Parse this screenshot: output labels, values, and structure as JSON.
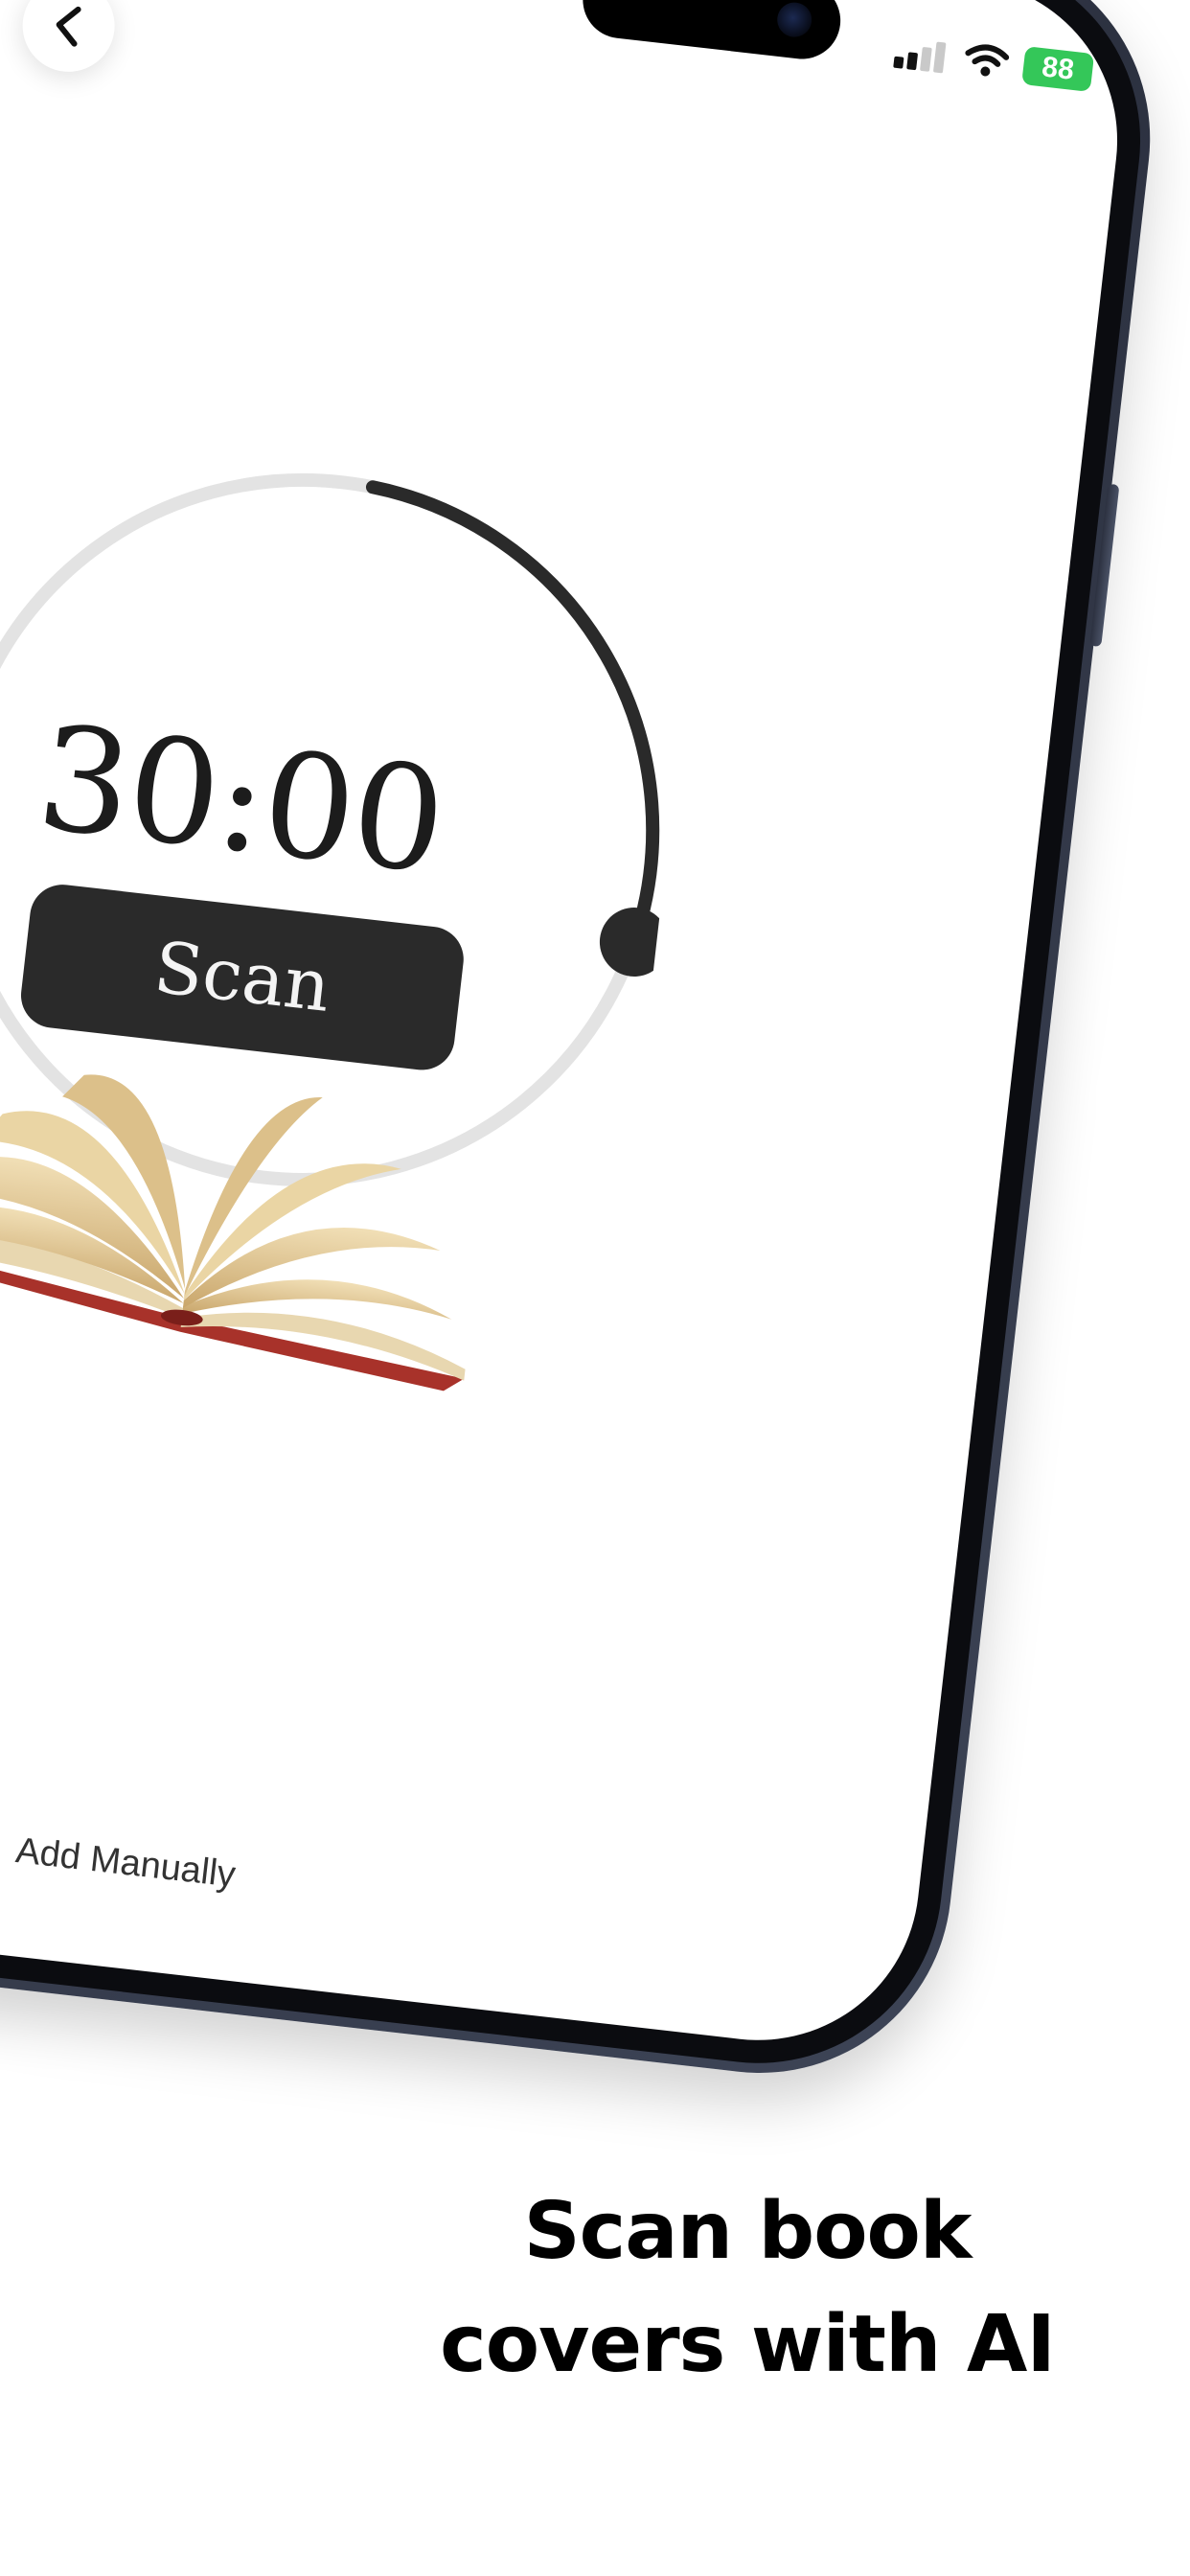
{
  "status_bar": {
    "battery_level": "88"
  },
  "timer": {
    "display": "30:00",
    "progress": 0.27
  },
  "scan_button": {
    "label": "Scan"
  },
  "add_manually": {
    "label": "Add Manually"
  },
  "headline": {
    "line1": "Scan book",
    "line2": "covers with AI"
  },
  "colors": {
    "accent": "#2a2a2a",
    "track": "#e3e3e3",
    "battery": "#34c759",
    "phone_frame": "#2c3140"
  },
  "icons": [
    "back-chevron-icon",
    "cellular-signal-icon",
    "wifi-icon",
    "battery-icon",
    "open-book-icon"
  ]
}
